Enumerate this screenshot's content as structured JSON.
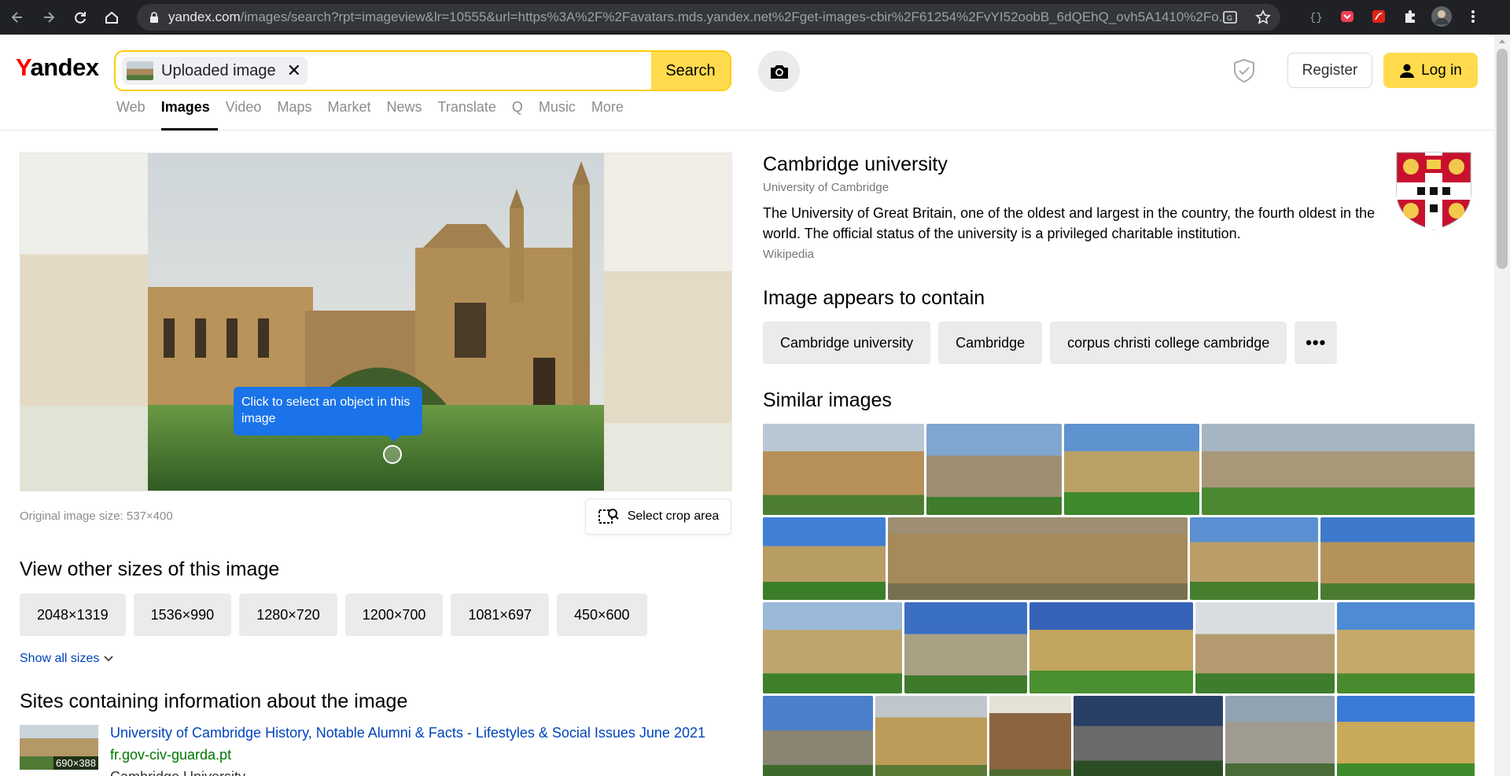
{
  "browser": {
    "url_host": "yandex.com",
    "url_rest": "/images/search?rpt=imageview&lr=10555&url=https%3A%2F%2Favatars.mds.yandex.net%2Fget-images-cbir%2F61254%2FvYI52oobB_6dQEhQ_ovh5A1410%2Fo..."
  },
  "header": {
    "logo_y": "Y",
    "logo_rest": "andex",
    "search_chip_label": "Uploaded image",
    "search_chip_close": "✕",
    "search_button": "Search",
    "register_label": "Register",
    "login_label": "Log in",
    "tabs": [
      "Web",
      "Images",
      "Video",
      "Maps",
      "Market",
      "News",
      "Translate",
      "Q",
      "Music",
      "More"
    ],
    "active_tab": "Images"
  },
  "viewer": {
    "tooltip": "Click to select an object in this image",
    "original_size": "Original image size: 537×400",
    "crop_button": "Select crop area"
  },
  "sizes": {
    "heading": "View other sizes of this image",
    "items": [
      "2048×1319",
      "1536×990",
      "1280×720",
      "1200×700",
      "1081×697",
      "450×600"
    ],
    "show_all": "Show all sizes"
  },
  "sites": {
    "heading": "Sites containing information about the image",
    "first": {
      "thumb_size": "690×388",
      "title": "University of Cambridge History, Notable Alumni & Facts - Lifestyles & Social Issues June 2021",
      "url": "fr.gov-civ-guarda.pt",
      "desc": "Cambridge University"
    }
  },
  "entity": {
    "title": "Cambridge university",
    "subtitle": "University of Cambridge",
    "description": "The University of Great Britain, one of the oldest and largest in the country, the fourth oldest in the world. The official status of the university is a privileged charitable institution.",
    "source": "Wikipedia"
  },
  "contains": {
    "heading": "Image appears to contain",
    "tags": [
      "Cambridge university",
      "Cambridge",
      "corpus christi college cambridge"
    ],
    "more": "•••"
  },
  "similar": {
    "heading": "Similar images"
  },
  "colors": {
    "accent_yellow": "#ffdb4d",
    "search_border": "#ffcc00",
    "link_blue": "#0044bb",
    "tooltip_blue": "#1a73e8"
  }
}
